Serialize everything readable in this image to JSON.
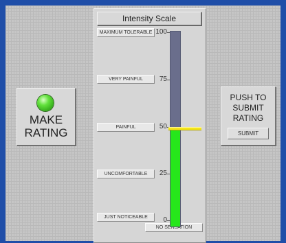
{
  "make_rating": {
    "label": "MAKE\nRATING",
    "indicator_color": "#4fd62c"
  },
  "scale": {
    "title": "Intensity Scale",
    "descriptors": [
      "MAXIMUM TOLERABLE",
      "VERY PAINFUL",
      "PAINFUL",
      "UNCOMFORTABLE",
      "JUST NOTICEABLE",
      "NO SENSATION"
    ],
    "ticks": [
      "100",
      "75",
      "50",
      "25",
      "0"
    ],
    "min": 0,
    "max": 100,
    "value": 50,
    "fill_color": "#26e71b",
    "track_color": "#6a6e8c",
    "slider_color": "#f4e51a"
  },
  "submit": {
    "label": "PUSH TO\nSUBMIT\nRATING",
    "button_label": "SUBMIT"
  }
}
